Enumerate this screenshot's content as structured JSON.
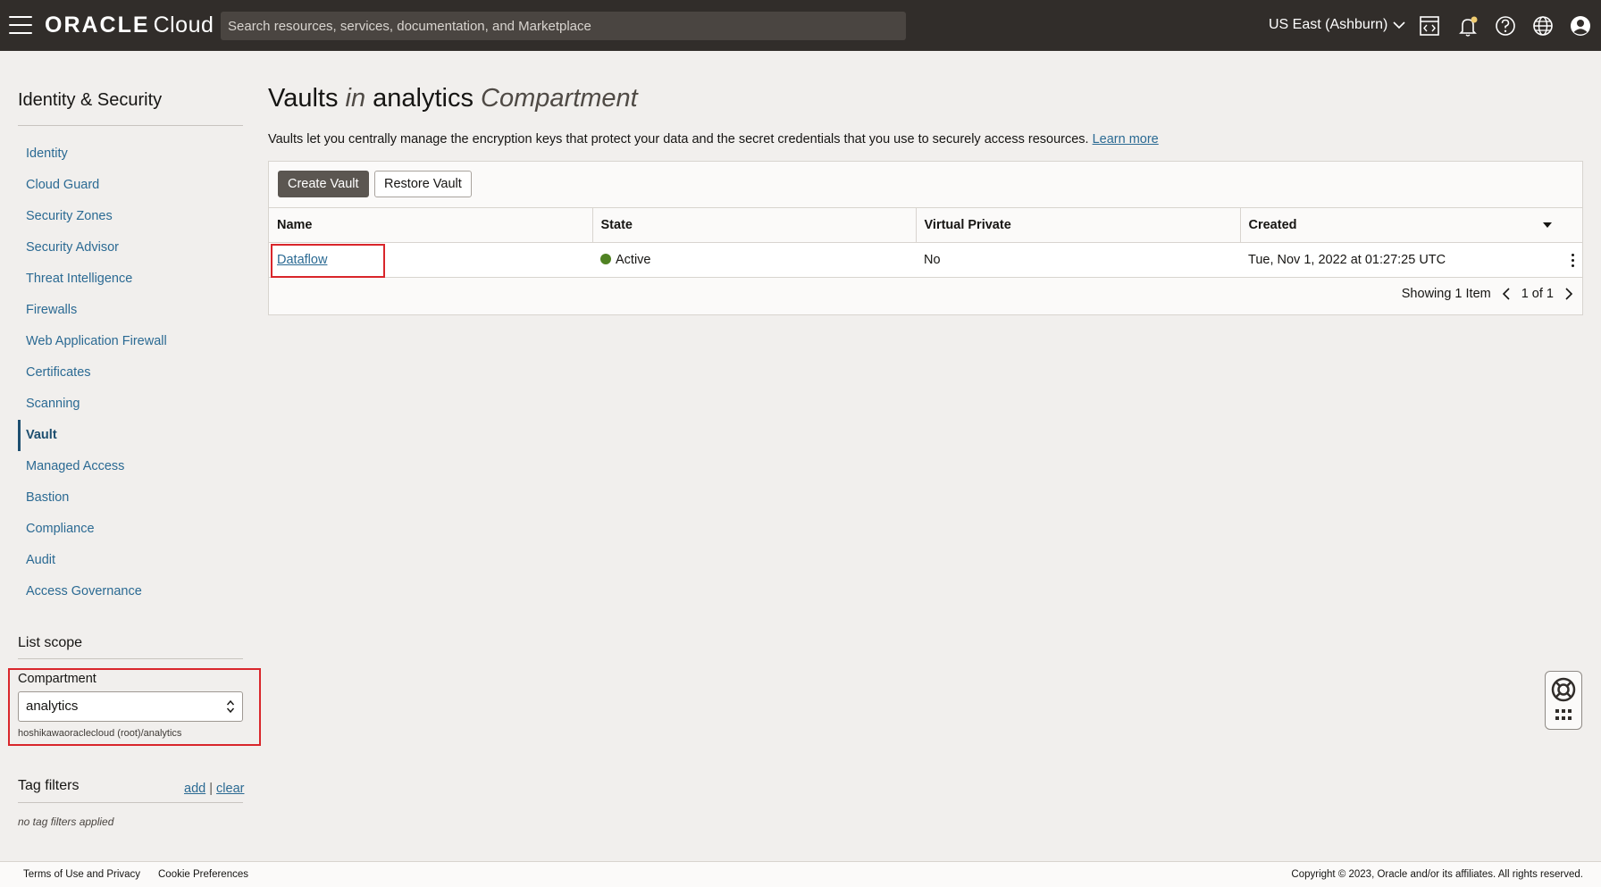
{
  "header": {
    "brand_oracle": "ORACLE",
    "brand_cloud": "Cloud",
    "search_placeholder": "Search resources, services, documentation, and Marketplace",
    "region": "US East (Ashburn)",
    "icons": [
      "menu-icon",
      "code-editor-icon",
      "bell-icon",
      "help-icon",
      "globe-icon",
      "profile-icon"
    ]
  },
  "sidebar": {
    "title": "Identity & Security",
    "items": [
      {
        "label": "Identity",
        "active": false
      },
      {
        "label": "Cloud Guard",
        "active": false
      },
      {
        "label": "Security Zones",
        "active": false
      },
      {
        "label": "Security Advisor",
        "active": false
      },
      {
        "label": "Threat Intelligence",
        "active": false
      },
      {
        "label": "Firewalls",
        "active": false
      },
      {
        "label": "Web Application Firewall",
        "active": false
      },
      {
        "label": "Certificates",
        "active": false
      },
      {
        "label": "Scanning",
        "active": false
      },
      {
        "label": "Vault",
        "active": true
      },
      {
        "label": "Managed Access",
        "active": false
      },
      {
        "label": "Bastion",
        "active": false
      },
      {
        "label": "Compliance",
        "active": false
      },
      {
        "label": "Audit",
        "active": false
      },
      {
        "label": "Access Governance",
        "active": false
      }
    ],
    "scope_title": "List scope",
    "compartment_label": "Compartment",
    "compartment_value": "analytics",
    "compartment_path": "hoshikawaoraclecloud (root)/analytics",
    "tag_filters_title": "Tag filters",
    "tag_add": "add",
    "tag_separator": "|",
    "tag_clear": "clear",
    "tag_none": "no tag filters applied"
  },
  "main": {
    "title_prefix": "Vaults",
    "title_in": "in",
    "title_compartment": "analytics",
    "title_suffix": "Compartment",
    "description": "Vaults let you centrally manage the encryption keys that protect your data and the secret credentials that you use to securely access resources.",
    "learn_more": "Learn more",
    "buttons": {
      "create": "Create Vault",
      "restore": "Restore Vault"
    },
    "table": {
      "columns": [
        "Name",
        "State",
        "Virtual Private",
        "Created"
      ],
      "rows": [
        {
          "name": "Dataflow",
          "state": "Active",
          "virtual_private": "No",
          "created": "Tue, Nov 1, 2022 at 01:27:25 UTC"
        }
      ],
      "state_color": "#508223"
    },
    "pager": {
      "showing": "Showing 1 Item",
      "page": "1 of 1"
    }
  },
  "footer": {
    "terms": "Terms of Use and Privacy",
    "cookies": "Cookie Preferences",
    "copyright": "Copyright © 2023, Oracle and/or its affiliates. All rights reserved."
  },
  "colors": {
    "header_bg": "#312d2a",
    "link": "#2b6a93",
    "highlight_box": "#d9262b"
  }
}
